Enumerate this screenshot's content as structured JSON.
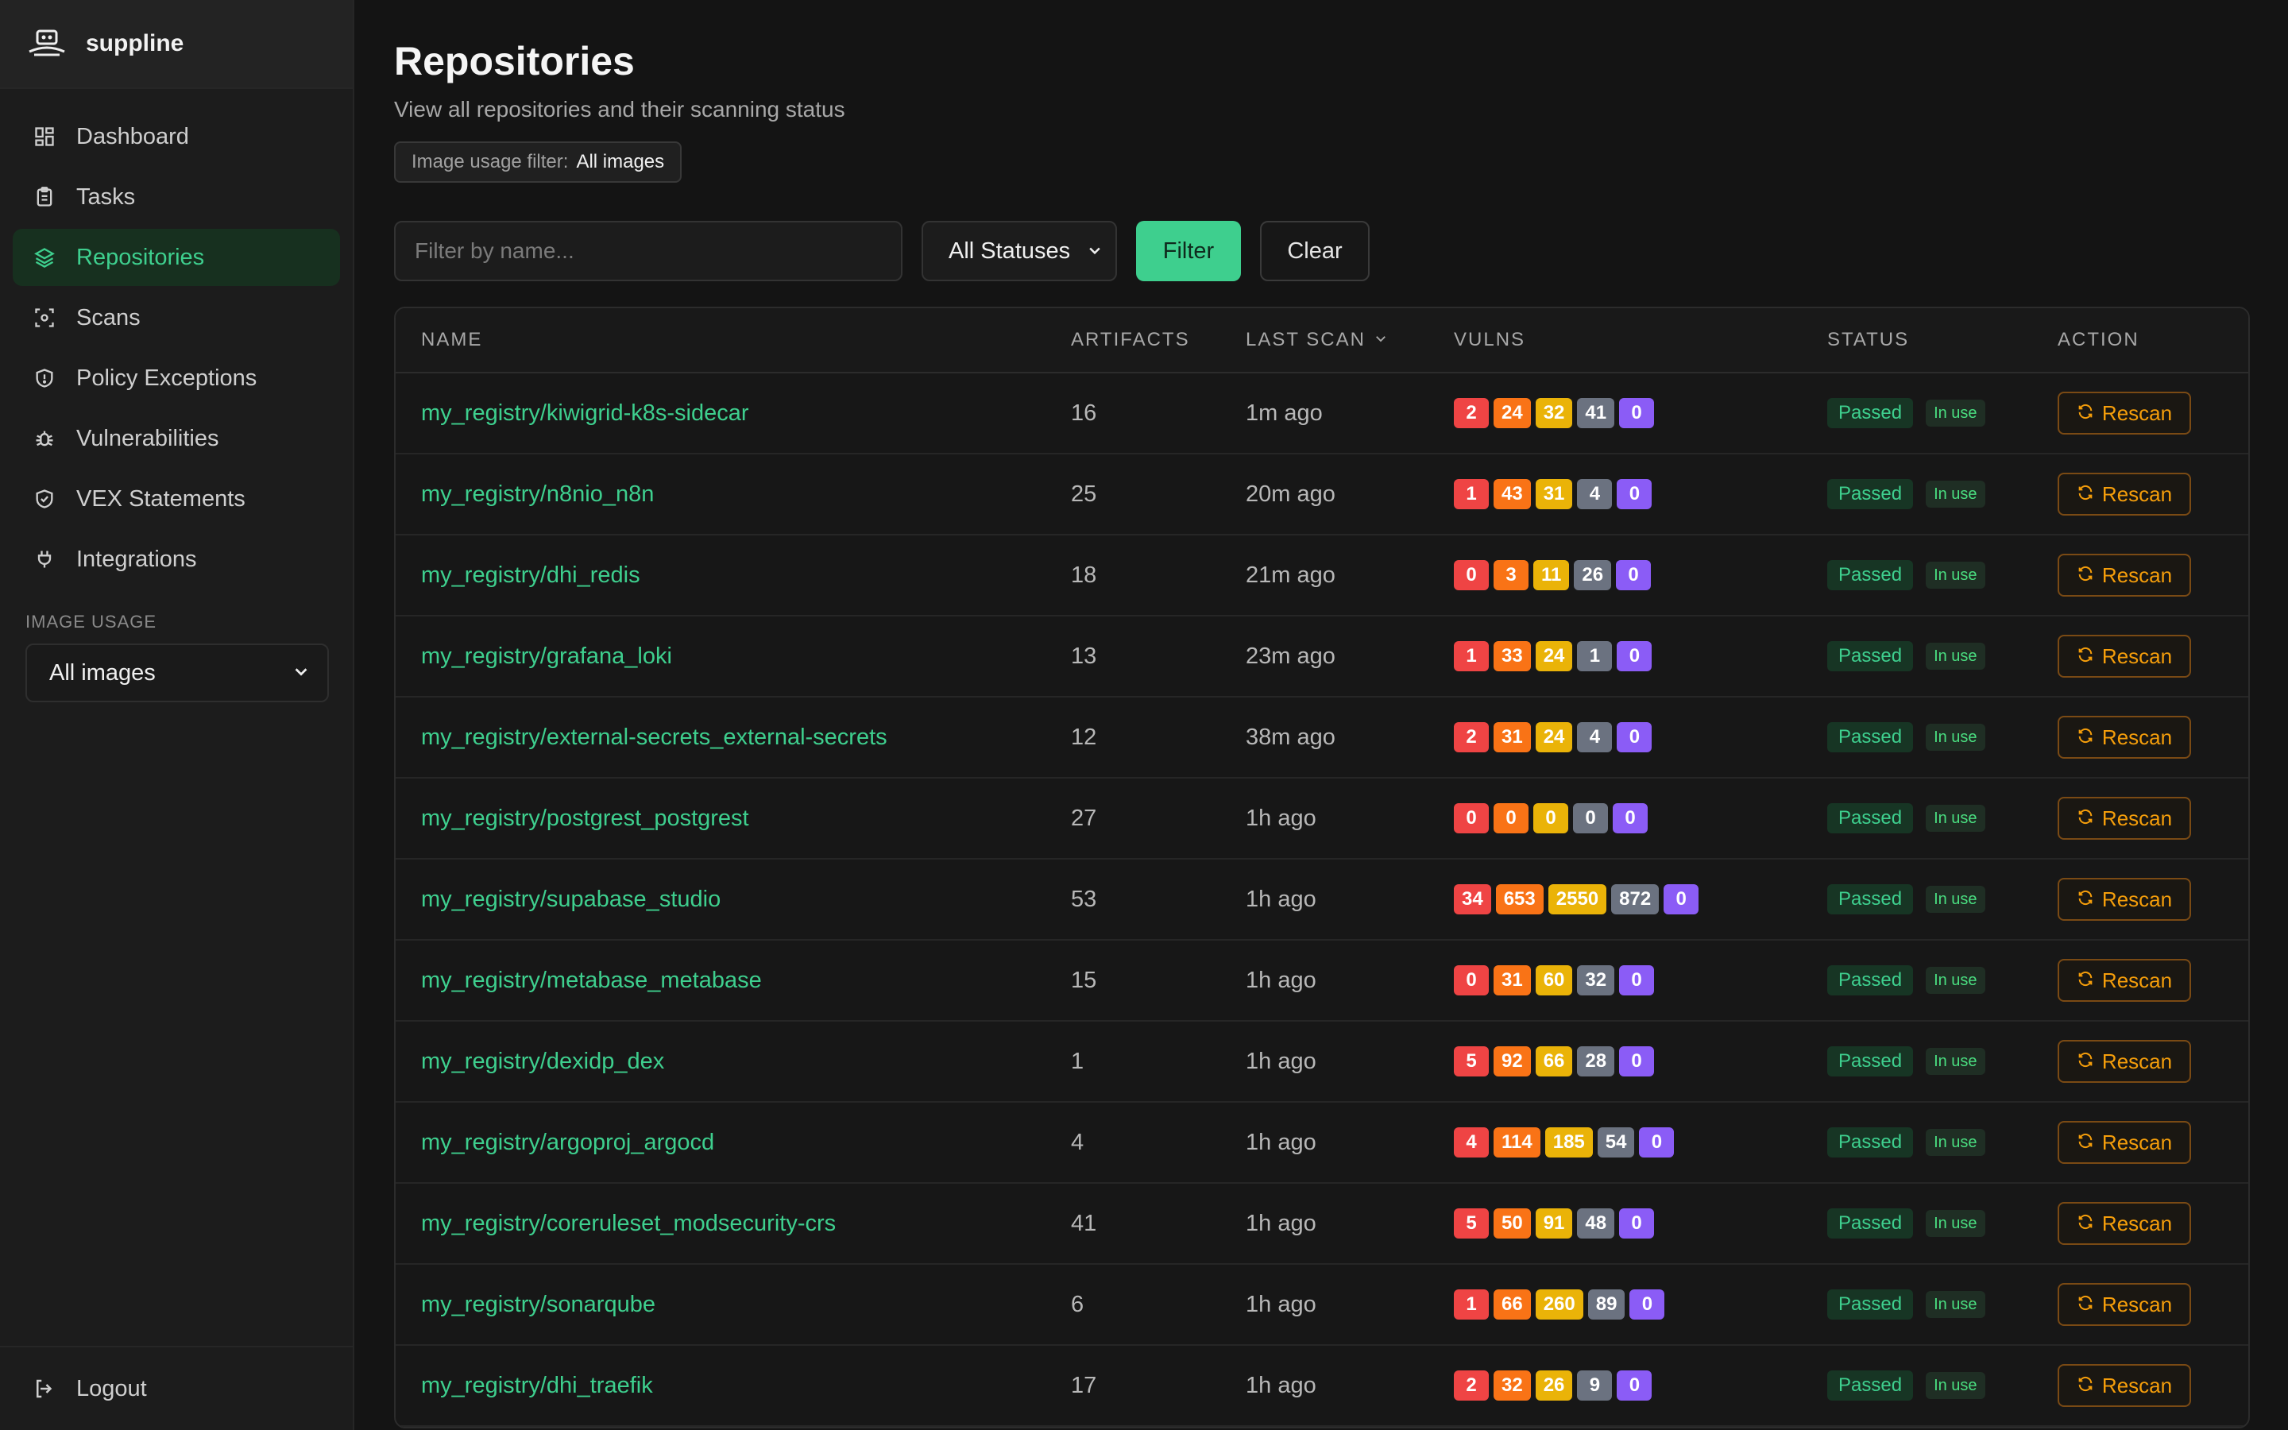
{
  "app": {
    "name": "suppline"
  },
  "sidebar": {
    "items": [
      {
        "label": "Dashboard",
        "icon": "dashboard-icon"
      },
      {
        "label": "Tasks",
        "icon": "clipboard-icon"
      },
      {
        "label": "Repositories",
        "icon": "layers-icon"
      },
      {
        "label": "Scans",
        "icon": "scan-icon"
      },
      {
        "label": "Policy Exceptions",
        "icon": "shield-icon"
      },
      {
        "label": "Vulnerabilities",
        "icon": "bug-icon"
      },
      {
        "label": "VEX Statements",
        "icon": "shield-check-icon"
      },
      {
        "label": "Integrations",
        "icon": "plug-icon"
      }
    ],
    "active_index": 2,
    "section_label": "IMAGE USAGE",
    "usage_value": "All images",
    "logout_label": "Logout"
  },
  "header": {
    "title": "Repositories",
    "subtitle": "View all repositories and their scanning status",
    "filter_chip_label": "Image usage filter:",
    "filter_chip_value": "All images"
  },
  "toolbar": {
    "search_placeholder": "Filter by name...",
    "status_value": "All Statuses",
    "filter_label": "Filter",
    "clear_label": "Clear"
  },
  "table": {
    "columns": [
      "NAME",
      "ARTIFACTS",
      "LAST SCAN",
      "VULNS",
      "STATUS",
      "ACTION"
    ],
    "rows": [
      {
        "name": "my_registry/kiwigrid-k8s-sidecar",
        "artifacts": "16",
        "last_scan": "1m ago",
        "vulns": [
          "2",
          "24",
          "32",
          "41",
          "0"
        ],
        "status": "Passed",
        "usage": "In use",
        "action": "Rescan"
      },
      {
        "name": "my_registry/n8nio_n8n",
        "artifacts": "25",
        "last_scan": "20m ago",
        "vulns": [
          "1",
          "43",
          "31",
          "4",
          "0"
        ],
        "status": "Passed",
        "usage": "In use",
        "action": "Rescan"
      },
      {
        "name": "my_registry/dhi_redis",
        "artifacts": "18",
        "last_scan": "21m ago",
        "vulns": [
          "0",
          "3",
          "11",
          "26",
          "0"
        ],
        "status": "Passed",
        "usage": "In use",
        "action": "Rescan"
      },
      {
        "name": "my_registry/grafana_loki",
        "artifacts": "13",
        "last_scan": "23m ago",
        "vulns": [
          "1",
          "33",
          "24",
          "1",
          "0"
        ],
        "status": "Passed",
        "usage": "In use",
        "action": "Rescan"
      },
      {
        "name": "my_registry/external-secrets_external-secrets",
        "artifacts": "12",
        "last_scan": "38m ago",
        "vulns": [
          "2",
          "31",
          "24",
          "4",
          "0"
        ],
        "status": "Passed",
        "usage": "In use",
        "action": "Rescan"
      },
      {
        "name": "my_registry/postgrest_postgrest",
        "artifacts": "27",
        "last_scan": "1h ago",
        "vulns": [
          "0",
          "0",
          "0",
          "0",
          "0"
        ],
        "status": "Passed",
        "usage": "In use",
        "action": "Rescan"
      },
      {
        "name": "my_registry/supabase_studio",
        "artifacts": "53",
        "last_scan": "1h ago",
        "vulns": [
          "34",
          "653",
          "2550",
          "872",
          "0"
        ],
        "status": "Passed",
        "usage": "In use",
        "action": "Rescan"
      },
      {
        "name": "my_registry/metabase_metabase",
        "artifacts": "15",
        "last_scan": "1h ago",
        "vulns": [
          "0",
          "31",
          "60",
          "32",
          "0"
        ],
        "status": "Passed",
        "usage": "In use",
        "action": "Rescan"
      },
      {
        "name": "my_registry/dexidp_dex",
        "artifacts": "1",
        "last_scan": "1h ago",
        "vulns": [
          "5",
          "92",
          "66",
          "28",
          "0"
        ],
        "status": "Passed",
        "usage": "In use",
        "action": "Rescan"
      },
      {
        "name": "my_registry/argoproj_argocd",
        "artifacts": "4",
        "last_scan": "1h ago",
        "vulns": [
          "4",
          "114",
          "185",
          "54",
          "0"
        ],
        "status": "Passed",
        "usage": "In use",
        "action": "Rescan"
      },
      {
        "name": "my_registry/coreruleset_modsecurity-crs",
        "artifacts": "41",
        "last_scan": "1h ago",
        "vulns": [
          "5",
          "50",
          "91",
          "48",
          "0"
        ],
        "status": "Passed",
        "usage": "In use",
        "action": "Rescan"
      },
      {
        "name": "my_registry/sonarqube",
        "artifacts": "6",
        "last_scan": "1h ago",
        "vulns": [
          "1",
          "66",
          "260",
          "89",
          "0"
        ],
        "status": "Passed",
        "usage": "In use",
        "action": "Rescan"
      },
      {
        "name": "my_registry/dhi_traefik",
        "artifacts": "17",
        "last_scan": "1h ago",
        "vulns": [
          "2",
          "32",
          "26",
          "9",
          "0"
        ],
        "status": "Passed",
        "usage": "In use",
        "action": "Rescan"
      }
    ]
  },
  "colors": {
    "accent": "#3ecf8e",
    "critical": "#ef4444",
    "high": "#f97316",
    "medium": "#eab308",
    "low": "#6b7280",
    "unknown": "#8b5cf6",
    "rescan": "#f59e0b"
  }
}
